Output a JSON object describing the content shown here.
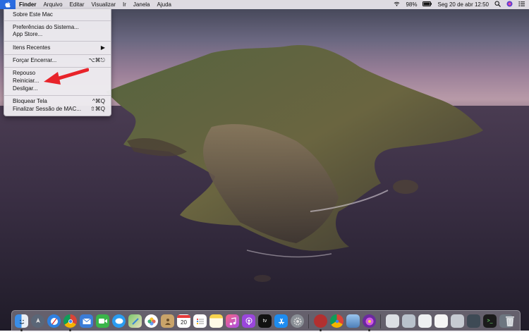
{
  "menubar": {
    "apple_icon": "apple-logo-icon",
    "app_name": "Finder",
    "menus": [
      "Arquivo",
      "Editar",
      "Visualizar",
      "Ir",
      "Janela",
      "Ajuda"
    ],
    "battery": "98%",
    "clock": "Seg 20 de abr  12:50"
  },
  "apple_menu": {
    "items": [
      {
        "label": "Sobre Este Mac",
        "shortcut": ""
      },
      {
        "label": "Preferências do Sistema...",
        "shortcut": ""
      },
      {
        "label": "App Store...",
        "shortcut": ""
      },
      {
        "label": "Itens Recentes",
        "shortcut": "▶"
      },
      {
        "label": "Forçar Encerrar...",
        "shortcut": "⌥⌘⎋"
      },
      {
        "label": "Repouso",
        "shortcut": ""
      },
      {
        "label": "Reiniciar...",
        "shortcut": ""
      },
      {
        "label": "Desligar...",
        "shortcut": ""
      },
      {
        "label": "Bloquear Tela",
        "shortcut": "^⌘Q"
      },
      {
        "label": "Finalizar Sessão de MAC...",
        "shortcut": "⇧⌘Q"
      }
    ]
  },
  "dock": {
    "icons": [
      "finder-icon",
      "launchpad-icon",
      "safari-icon",
      "chrome-icon",
      "mail-icon",
      "facetime-icon",
      "messages-icon",
      "maps-icon",
      "photos-icon",
      "contacts-icon",
      "calendar-icon",
      "reminders-icon",
      "notes-icon",
      "music-icon",
      "podcasts-icon",
      "tv-icon",
      "app-store-icon",
      "system-preferences-icon",
      "photo-booth-icon",
      "chrome-canary-icon",
      "preview-icon",
      "flower-app-icon",
      "screenshot-icon",
      "folder-icon",
      "document-icon",
      "document-icon-2",
      "terminal-icon",
      "trash-icon"
    ],
    "calendar_day": "20"
  }
}
